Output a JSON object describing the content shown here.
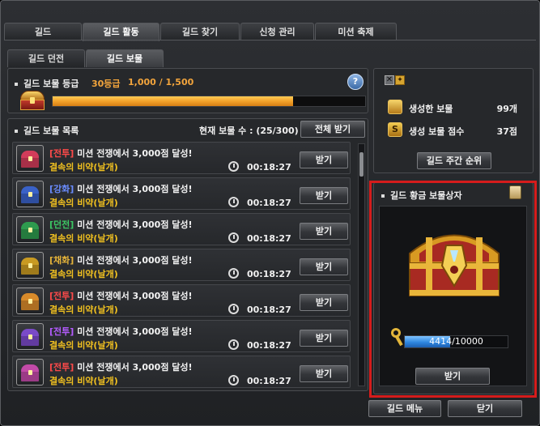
{
  "tabs": [
    "길드",
    "길드 활동",
    "길드 찾기",
    "신청 관리",
    "미션 축제"
  ],
  "active_tab": 1,
  "subtabs": [
    "길드 던전",
    "길드 보물"
  ],
  "active_subtab": 1,
  "grade": {
    "title": "길드 보물 등급",
    "level": "30등급",
    "progress_text": "1,000 / 1,500",
    "progress_fraction": 0.77,
    "help": "?"
  },
  "list": {
    "title": "길드 보물 목록",
    "count_text": "현재 보물 수 : (25/300)",
    "receive_all": "전체 받기",
    "items": [
      {
        "tag": "[전투]",
        "tag_color": "#ff4a4a",
        "chest_color": "#d23c5a",
        "text": "미션 전쟁에서 3,000점 달성!",
        "reward": "결속의 비약(날개)",
        "time": "00:18:27",
        "button": "받기"
      },
      {
        "tag": "[강화]",
        "tag_color": "#6a8cff",
        "chest_color": "#3a62c8",
        "text": "미션 전쟁에서 3,000점 달성!",
        "reward": "결속의 비약(날개)",
        "time": "00:18:27",
        "button": "받기"
      },
      {
        "tag": "[던전]",
        "tag_color": "#3cc864",
        "chest_color": "#2e9a4e",
        "text": "미션 전쟁에서 3,000점 달성!",
        "reward": "결속의 비약(날개)",
        "time": "00:18:27",
        "button": "받기"
      },
      {
        "tag": "[채화]",
        "tag_color": "#e6b43a",
        "chest_color": "#c89a22",
        "text": "미션 전쟁에서 3,000점 달성!",
        "reward": "결속의 비약(날개)",
        "time": "00:18:27",
        "button": "받기"
      },
      {
        "tag": "[전투]",
        "tag_color": "#ff4a4a",
        "chest_color": "#d88a2a",
        "text": "미션 전쟁에서 3,000점 달성!",
        "reward": "결속의 비약(날개)",
        "time": "00:18:27",
        "button": "받기"
      },
      {
        "tag": "[전투]",
        "tag_color": "#b45cff",
        "chest_color": "#7a4ac8",
        "text": "미션 전쟁에서 3,000점 달성!",
        "reward": "결속의 비약(날개)",
        "time": "00:18:27",
        "button": "받기"
      },
      {
        "tag": "[전투]",
        "tag_color": "#ff4a4a",
        "chest_color": "#c24aa8",
        "text": "미션 전쟁에서 3,000점 달성!",
        "reward": "결속의 비약(날개)",
        "time": "00:18:27",
        "button": "받기"
      }
    ]
  },
  "stats": {
    "created_label": "생성한 보물",
    "created_value": "99개",
    "score_label": "생성 보물 점수",
    "score_value": "37점",
    "s_icon": "S",
    "ranking_button": "길드 주간 순위"
  },
  "golden_chest": {
    "title": "길드 황금 보물상자",
    "progress_text": "4414/10000",
    "progress_fraction": 0.4414,
    "button": "받기"
  },
  "footer": {
    "guild_menu": "길드 메뉴",
    "close": "닫기"
  }
}
